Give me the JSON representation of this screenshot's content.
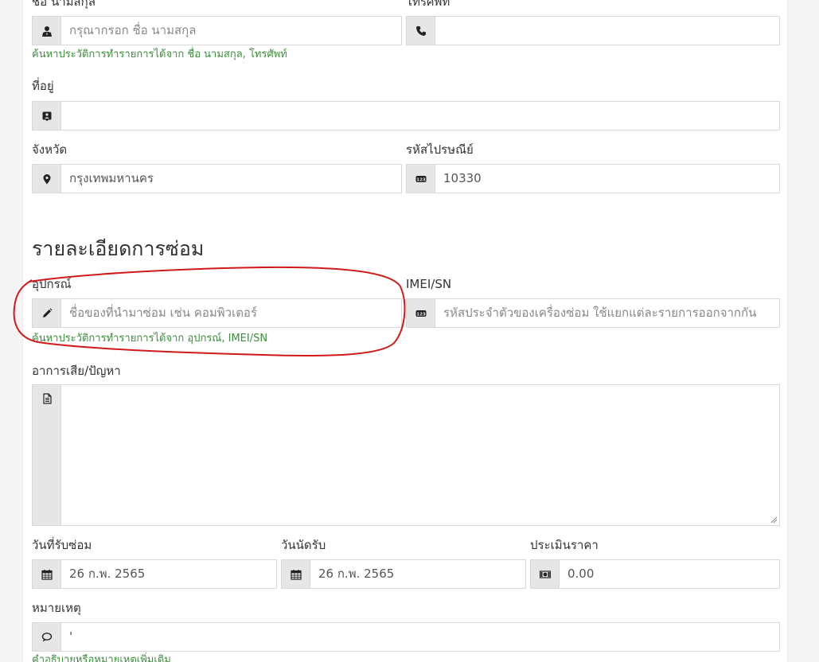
{
  "customer": {
    "name_label": "ชื่อ นามสกุล",
    "name_placeholder": "กรุณากรอก ชื่อ นามสกุล",
    "phone_label": "โทรศัพท์",
    "phone_value": "",
    "search_hint": "ค้นหาประวัติการทำรายการได้จาก ชื่อ นามสกุล, โทรศัพท์",
    "address_label": "ที่อยู่",
    "address_value": "",
    "province_label": "จังหวัด",
    "province_value": "กรุงเทพมหานคร",
    "zipcode_label": "รหัสไปรษณีย์",
    "zipcode_value": "10330"
  },
  "repair": {
    "section_title": "รายละเอียดการซ่อม",
    "device_label": "อุปกรณ์",
    "device_placeholder": "ชื่อของที่นำมาซ่อม เช่น คอมพิวเตอร์",
    "imei_label": "IMEI/SN",
    "imei_placeholder": "รหัสประจำตัวของเครื่องซ่อม ใช้แยกแต่ละรายการออกจากกัน",
    "search_hint": "ค้นหาประวัติการทำรายการได้จาก อุปกรณ์, IMEI/SN",
    "symptom_label": "อาการเสีย/ปัญหา",
    "symptom_value": "",
    "received_label": "วันที่รับซ่อม",
    "received_value": "26 ก.พ. 2565",
    "appointment_label": "วันนัดรับ",
    "appointment_value": "26 ก.พ. 2565",
    "estimate_label": "ประเมินราคา",
    "estimate_value": "0.00",
    "note_label": "หมายเหตุ",
    "note_value": "'",
    "note_hint": "คำอธิบายหรือหมายเหตุเพิ่มเติม"
  },
  "colors": {
    "hint_green": "#3c8e3c",
    "annotation_red": "#d11a1a",
    "addon_gray": "#e6e6e6"
  }
}
